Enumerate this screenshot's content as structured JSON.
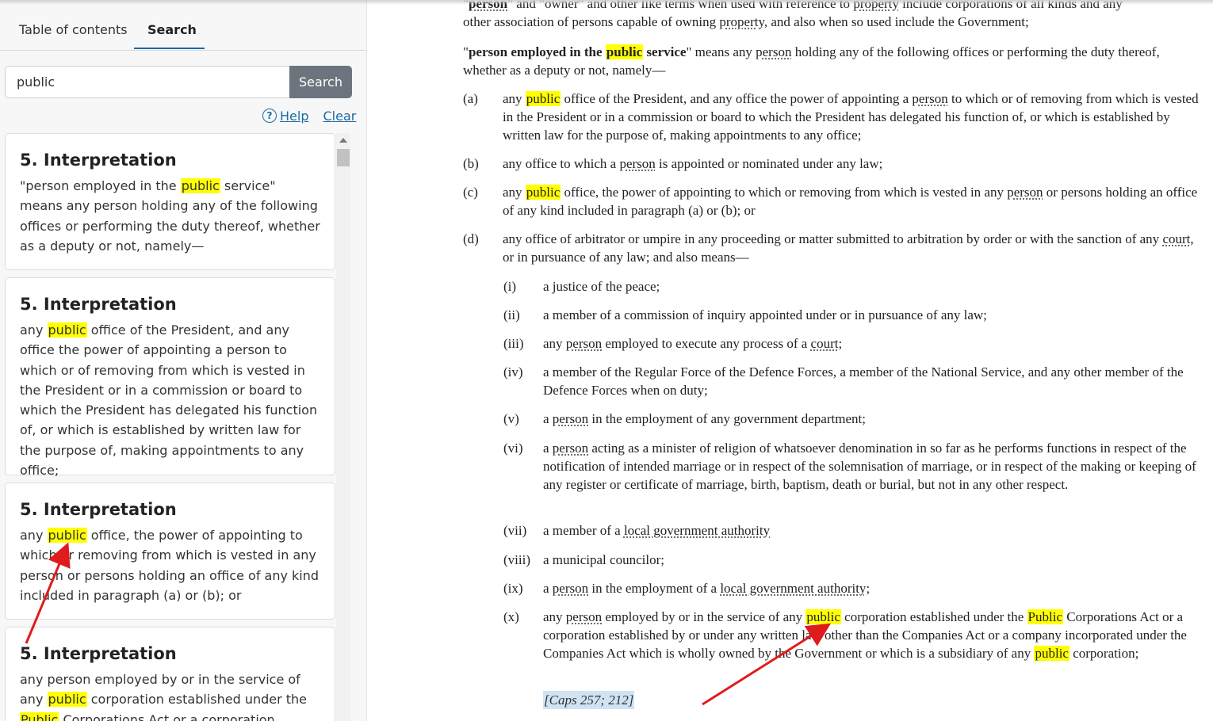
{
  "sidebar": {
    "tabs": [
      {
        "label": "Table of contents",
        "active": false
      },
      {
        "label": "Search",
        "active": true
      }
    ],
    "search": {
      "value": "public",
      "button_label": "Search"
    },
    "help_label": "Help",
    "clear_label": "Clear",
    "results": [
      {
        "title": "5. Interpretation",
        "parts": [
          "\"person employed in the ",
          "public",
          " service\" means any person holding any of the following offices or performing the duty thereof, whether as a deputy or not, namely—"
        ]
      },
      {
        "title": "5. Interpretation",
        "parts": [
          "any ",
          "public",
          " office of the President, and any office the power of appointing a person to which or of removing from which is vested in the President or in a commission or board to which the President has delegated his function of, or which is established by written law for the purpose of, making appointments to any office;"
        ]
      },
      {
        "title": "5. Interpretation",
        "parts": [
          "any ",
          "public",
          " office, the power of appointing to which or removing from which is vested in any person or persons holding an office of any kind included in paragraph (a) or (b); or"
        ]
      },
      {
        "title": "5. Interpretation",
        "parts": [
          "any person employed by or in the service of any ",
          "public",
          " corporation established under the ",
          "Public",
          " Corporations Act or a corporation established by"
        ]
      }
    ]
  },
  "doc": {
    "intro_line1": {
      "q1": "\"",
      "term1": "person",
      "mid": "\" and \"owner\" and other like terms when used with reference to ",
      "property": "property",
      "rest": " include corporations of all kinds and any"
    },
    "intro_line2": {
      "pre": "other association of persons capable of owning ",
      "property": "property",
      "rest": ", and also when so used include the Government;"
    },
    "definition": {
      "q1": "\"",
      "bold1": "person employed in the ",
      "hl": "public",
      "bold2": " service",
      "q2": "\"",
      "m1": " means any ",
      "person": "person",
      "rest": " holding any of the following offices or performing the duty thereof, whether as a deputy or not, namely—"
    },
    "a": {
      "label": "(a)",
      "pre": "any ",
      "hl": "public",
      "m1": " office of the President, and any office the power of appointing a ",
      "person": "person",
      "rest": " to which or of removing from which is vested in the President or in a commission or board to which the President has delegated his function of, or which is established by written law for the purpose of, making appointments to any office;"
    },
    "b": {
      "label": "(b)",
      "pre": "any office to which a ",
      "person": "person",
      "rest": " is appointed or nominated under any law;"
    },
    "c": {
      "label": "(c)",
      "pre": "any ",
      "hl": "public",
      "m1": " office, the power of appointing to which or removing from which is vested in any ",
      "person": "person",
      "rest": " or persons holding an office of any kind included in paragraph (a) or (b); or"
    },
    "d": {
      "label": "(d)",
      "pre": "any office of arbitrator or umpire in any proceeding or matter submitted to arbitration by order or with the sanction of any ",
      "court": "court",
      "rest": ", or in pursuance of any law; and also means—"
    },
    "i": {
      "label": "(i)",
      "text": "a justice of the peace;"
    },
    "ii": {
      "label": "(ii)",
      "text": "a member of a commission of inquiry appointed under or in pursuance of any law;"
    },
    "iii": {
      "label": "(iii)",
      "pre": "any ",
      "person": "person",
      "m1": " employed to execute any process of a ",
      "court": "court",
      "rest": ";"
    },
    "iv": {
      "label": "(iv)",
      "text": "a member of the Regular Force of the Defence Forces, a member of the National Service, and any other member of the Defence Forces when on duty;"
    },
    "v": {
      "label": "(v)",
      "pre": "a ",
      "person": "person",
      "rest": " in the employment of any government department;"
    },
    "vi": {
      "label": "(vi)",
      "pre": "a ",
      "person": "person",
      "rest": " acting as a minister of religion of whatsoever denomination in so far as he performs functions in respect of the notification of intended marriage or in respect of the solemnisation of marriage, or in respect of the making or keeping of any register or certificate of marriage, birth, baptism, death or burial, but not in any other respect."
    },
    "vii": {
      "label": "(vii)",
      "pre": "a member of a ",
      "lga": "local government authority"
    },
    "viii": {
      "label": "(viii)",
      "text": "a municipal councilor;"
    },
    "ix": {
      "label": "(ix)",
      "pre": "a ",
      "person": "person",
      "m1": " in the employment of a ",
      "lga": "local government authority",
      "rest": ";"
    },
    "x": {
      "label": "(x)",
      "pre": "any ",
      "person": "person",
      "m1": " employed by or in the service of any ",
      "hl1": "public",
      "m2": " corporation established under the ",
      "hl2": "Public",
      "m3": " Corporations Act or a corporation established by or under any written law other than the Companies Act or a company incorporated under the Companies Act which is wholly owned by the Government or which is a subsidiary of any ",
      "hl3": "public",
      "rest": " corporation;"
    },
    "caps": "[Caps 257; 212]"
  },
  "colors": {
    "highlight": "#ffff00",
    "arrow": "#e01b1b",
    "link": "#1b6aa5",
    "search_button": "#6c757d"
  }
}
